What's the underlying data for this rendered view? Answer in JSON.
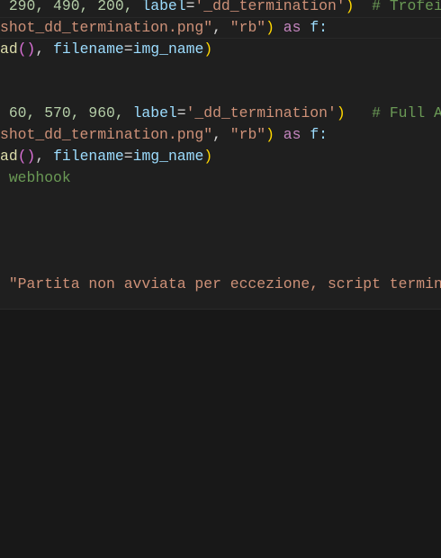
{
  "editor": {
    "lines": [
      {
        "tokens": [
          " ",
          "290, 490, 200, ",
          "label",
          "=",
          "'_dd_termination'",
          ")",
          "  # Trofei"
        ]
      },
      {
        "tokens": [
          "shot_dd_termination.png\"",
          ", ",
          "\"rb\"",
          ")",
          " as ",
          "f:"
        ]
      },
      {
        "tokens": [
          "ad",
          "(",
          ")",
          ", ",
          "filename",
          "=",
          "img_name",
          ")"
        ]
      },
      {
        "tokens": [
          " ",
          "60, 570, 960, ",
          "label",
          "=",
          "'_dd_termination'",
          ")",
          "   # Full Ap"
        ]
      },
      {
        "tokens": [
          "shot_dd_termination.png\"",
          ", ",
          "\"rb\"",
          ")",
          " as ",
          "f:"
        ]
      },
      {
        "tokens": [
          "ad",
          "(",
          ")",
          ", ",
          "filename",
          "=",
          "img_name",
          ")"
        ]
      },
      {
        "tokens": [
          " ",
          "webhook"
        ]
      },
      {
        "tokens": [
          " ",
          "\"Partita non avviata per eccezione, script termina"
        ]
      }
    ]
  },
  "colors": {
    "background": "#1f1f1f",
    "panel": "#181818",
    "string": "#ce9178",
    "number": "#b5cea8",
    "comment": "#6a9955"
  }
}
